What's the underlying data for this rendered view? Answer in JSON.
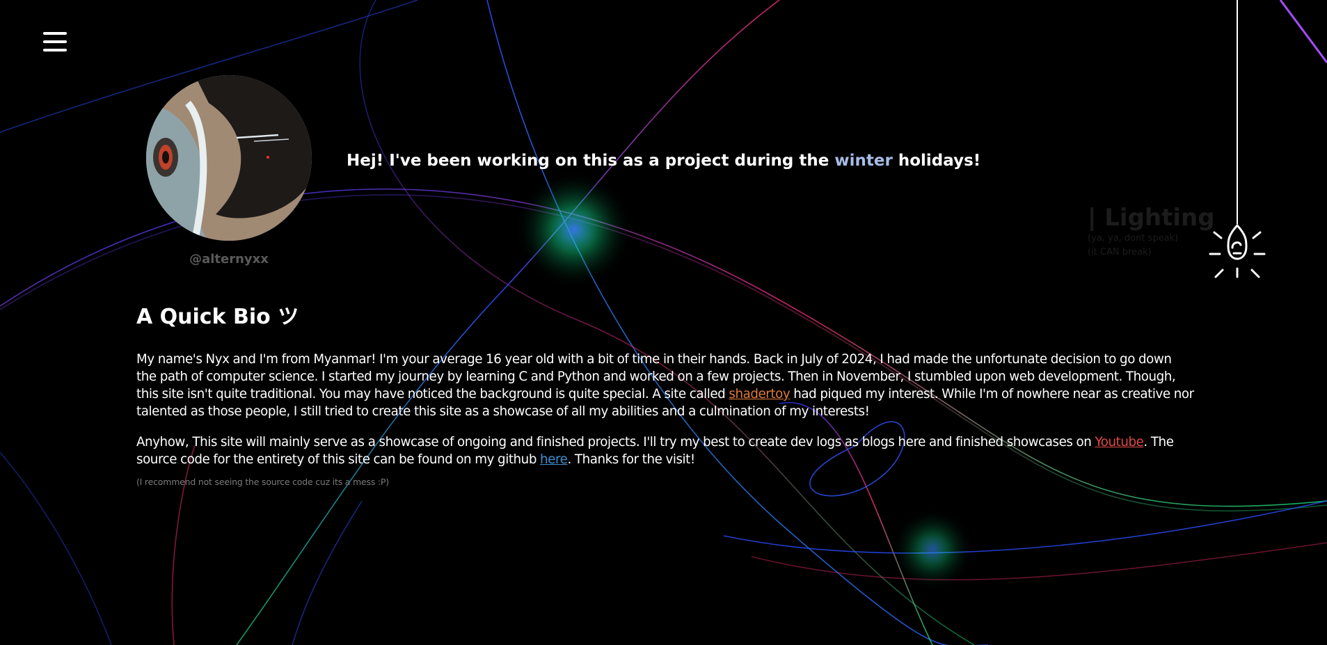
{
  "nav": {
    "menu_icon": "hamburger-menu-icon"
  },
  "profile": {
    "handle": "@alternyxx",
    "greeting_before": "Hej! I've been working on this as a project during the ",
    "greeting_highlight": "winter",
    "greeting_after": " holidays!"
  },
  "lighting": {
    "title": "| Lighting",
    "subtitle_1": "(ya, ya, dont speak)",
    "subtitle_2": "(it CAN break)",
    "bulb_icon": "light-bulb-icon"
  },
  "bio": {
    "title": "A Quick Bio ツ",
    "p1_before": "My name's Nyx and I'm from Myanmar! I'm your average 16 year old with a bit of time in their hands. Back in July of 2024, I had made the unfortunate decision to go down the path of computer science. I started my journey by learning C and Python and worked on a few projects. Then in November, I stumbled upon web development. Though, this site isn't quite traditional. You may have noticed the background is quite special. A site called ",
    "p1_link": "shadertoy",
    "p1_after": " had piqued my interest. While I'm of nowhere near as creative nor talented as those people, I still tried to create this site as a showcase of all my abilities and a culmination of my interests!",
    "p2_before": "Anyhow, This site will mainly serve as a showcase of ongoing and finished projects. I'll try my best to create dev logs as blogs here and finished showcases on ",
    "p2_link1": "Youtube",
    "p2_middle": ". The source code for the entirety of this site can be found on my github ",
    "p2_link2": "here",
    "p2_after": ". Thanks for the visit!",
    "note": "(I recommend not seeing the source code cuz its a mess :P)"
  },
  "colors": {
    "background": "#000000",
    "winter": "#a7bde6",
    "shadertoy_link": "#e07a3a",
    "youtube_link": "#e04848",
    "here_link": "#3f8fd0",
    "muted": "#5a5a5a"
  }
}
